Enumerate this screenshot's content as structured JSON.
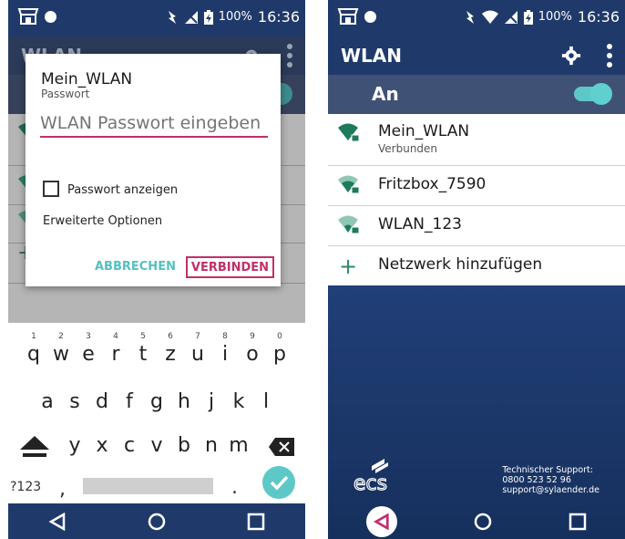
{
  "left": {
    "status": {
      "battery": "100%",
      "time": "16:36"
    },
    "app_title": "WLAN",
    "dialog": {
      "title": "Mein_WLAN",
      "subtitle": "Passwort",
      "password_placeholder": "WLAN Passwort eingeben",
      "show_password_label": "Passwort anzeigen",
      "advanced_label": "Erweiterte Optionen",
      "cancel_label": "ABBRECHEN",
      "connect_label": "VERBINDEN"
    },
    "keyboard": {
      "row1": [
        "q",
        "w",
        "e",
        "r",
        "t",
        "z",
        "u",
        "i",
        "o",
        "p"
      ],
      "row1_nums": [
        "1",
        "2",
        "3",
        "4",
        "5",
        "6",
        "7",
        "8",
        "9",
        "0"
      ],
      "row2": [
        "a",
        "s",
        "d",
        "f",
        "g",
        "h",
        "j",
        "k",
        "l"
      ],
      "row3": [
        "y",
        "x",
        "c",
        "v",
        "b",
        "n",
        "m"
      ],
      "symbols_label": "?123",
      "comma": ",",
      "dot": "."
    }
  },
  "right": {
    "status": {
      "battery": "100%",
      "time": "16:36"
    },
    "app_title": "WLAN",
    "toggle_label": "An",
    "networks": [
      {
        "name": "Mein_WLAN",
        "status": "Verbunden"
      },
      {
        "name": "Fritzbox_7590"
      },
      {
        "name": "WLAN_123"
      }
    ],
    "add_network": "Netzwerk hinzufügen",
    "support": {
      "line1": "Technischer Support:",
      "line2": "0800 523 52 96",
      "line3": "support@sylaender.de"
    }
  },
  "colors": {
    "dark_blue": "#1f3a6a",
    "accent_pink": "#c0306a",
    "accent_teal": "#5ec8c8",
    "wifi_green": "#2c8a6c"
  }
}
